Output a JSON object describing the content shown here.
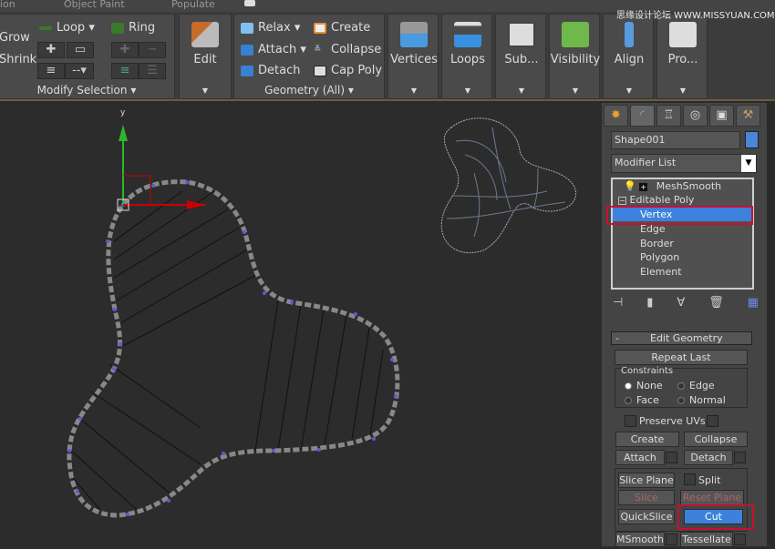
{
  "ribbon_tabs": [
    "ion",
    "Object Paint",
    "Populate"
  ],
  "watermark": "思缘设计论坛 WWW.MISSYUAN.COM",
  "modify_selection": {
    "grow": "Grow",
    "shrink": "Shrink",
    "loop": "Loop",
    "ring": "Ring",
    "label": "Modify Selection"
  },
  "edit": {
    "label": "Edit"
  },
  "geometry_all": {
    "relax": "Relax",
    "attach": "Attach",
    "detach": "Detach",
    "create": "Create",
    "collapse": "Collapse",
    "cap_poly": "Cap Poly",
    "label": "Geometry (All)"
  },
  "big_buttons": [
    "Vertices",
    "Loops",
    "Sub...",
    "Visibility",
    "Align",
    "Pro..."
  ],
  "viewport": {
    "axis_y": "y",
    "axis_x": "x"
  },
  "command_panel": {
    "object_name": "Shape001",
    "object_color": "#4a86d8",
    "modifier_list": "Modifier List",
    "stack": [
      {
        "label": "MeshSmooth"
      },
      {
        "label": "Editable Poly"
      },
      {
        "label": "Vertex",
        "selected": true
      },
      {
        "label": "Edge"
      },
      {
        "label": "Border"
      },
      {
        "label": "Polygon"
      },
      {
        "label": "Element"
      }
    ],
    "rollout_title": "Edit Geometry",
    "rollout_collapse": "-",
    "repeat_last": "Repeat Last",
    "constraints": {
      "title": "Constraints",
      "options": [
        "None",
        "Edge",
        "Face",
        "Normal"
      ],
      "selected": "None"
    },
    "preserve_uvs": "Preserve UVs",
    "create": "Create",
    "collapse": "Collapse",
    "attach": "Attach",
    "detach": "Detach",
    "slice_plane": "Slice Plane",
    "split": "Split",
    "slice": "Slice",
    "reset_plane": "Reset Plane",
    "quickslice": "QuickSlice",
    "cut": "Cut",
    "msmooth": "MSmooth",
    "tessellate": "Tessellate"
  },
  "colors": {
    "selection": "#3c82dc",
    "highlight": "#c8102e",
    "vertex": "#5a5adc"
  }
}
